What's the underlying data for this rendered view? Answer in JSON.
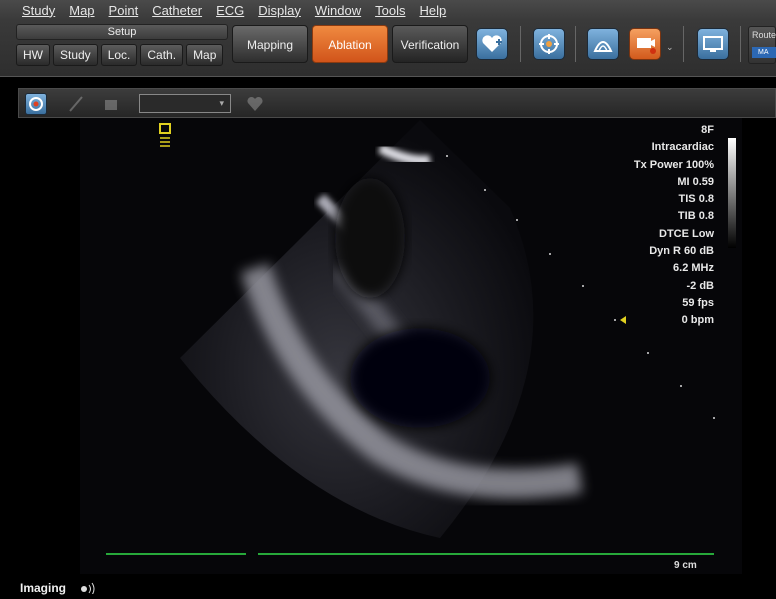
{
  "menu": [
    "Study",
    "Map",
    "Point",
    "Catheter",
    "ECG",
    "Display",
    "Window",
    "Tools",
    "Help"
  ],
  "setup": {
    "title": "Setup",
    "buttons": [
      "HW",
      "Study",
      "Loc.",
      "Cath.",
      "Map"
    ]
  },
  "modes": {
    "mapping": "Mapping",
    "ablation": "Ablation",
    "verification": "Verification",
    "active": "Ablation"
  },
  "toolbar_icons": [
    "heart-plus-icon",
    "target-icon",
    "shell-icon",
    "camera-icon",
    "monitor-icon"
  ],
  "route": {
    "label": "Route",
    "chip": "MA"
  },
  "ultrasound": {
    "readout": [
      "8F",
      "Intracardiac",
      "Tx Power 100%",
      "MI 0.59",
      "TIS 0.8",
      "TIB 0.8",
      "DTCE Low",
      "Dyn R 60 dB",
      "6.2 MHz",
      "-2 dB",
      "59 fps",
      "0 bpm"
    ],
    "scale": "9 cm"
  },
  "status": {
    "label": "Imaging"
  },
  "colors": {
    "ablation": "#e0651f",
    "icon_blue": "#4a85bb",
    "ecg_line": "#27a83a",
    "depth_marker": "#e0d020"
  }
}
